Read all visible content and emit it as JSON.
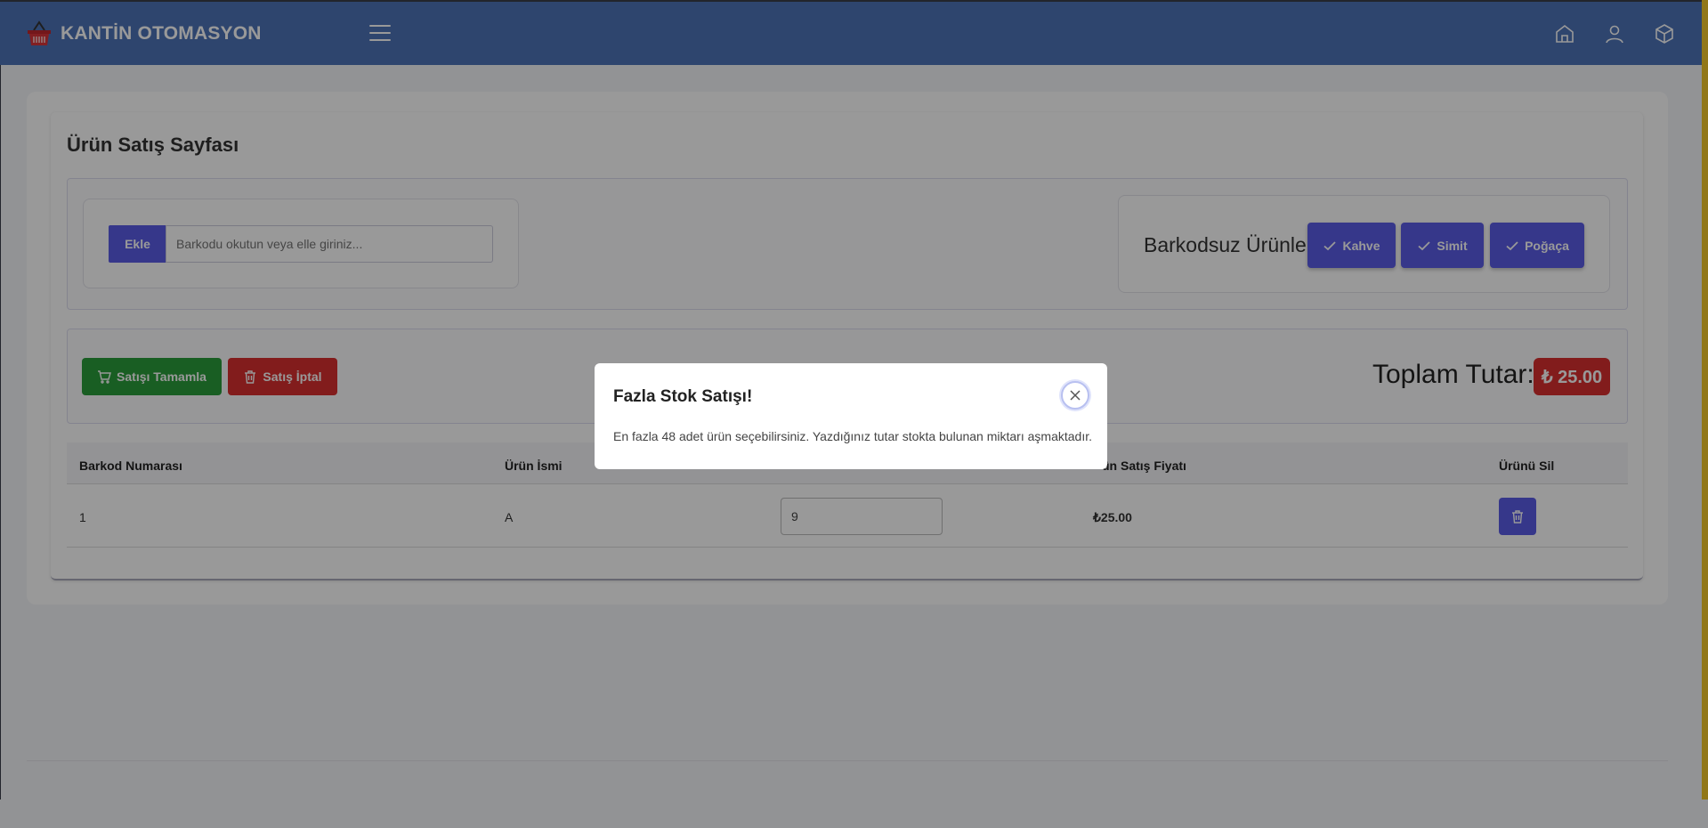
{
  "header": {
    "brand_title": "KANTİN OTOMASYON",
    "brand_color": "#4e73b8",
    "icons": [
      "home-icon",
      "user-icon",
      "box-icon"
    ]
  },
  "page": {
    "title": "Ürün Satış Sayfası"
  },
  "barcode": {
    "add_label": "Ekle",
    "placeholder": "Barkodu okutun veya elle giriniz..."
  },
  "no_barcode": {
    "label": "Barkodsuz Ürünler",
    "products": [
      {
        "label": "Kahve"
      },
      {
        "label": "Simit"
      },
      {
        "label": "Poğaça"
      }
    ]
  },
  "actions": {
    "complete_label": "Satışı Tamamla",
    "cancel_label": "Satış İptal",
    "complete_color": "#2a9d3b",
    "cancel_color": "#d93030"
  },
  "total": {
    "label": "Toplam Tutar:",
    "value": "₺ 25.00"
  },
  "table": {
    "headers": [
      "Barkod Numarası",
      "Ürün İsmi",
      "",
      "ün Satış Fiyatı",
      "Ürünü Sil"
    ],
    "rows": [
      {
        "barcode": "1",
        "name": "A",
        "quantity": "9",
        "price": "₺25.00"
      }
    ]
  },
  "modal": {
    "title": "Fazla Stok Satışı!",
    "message": "En fazla 48 adet ürün seçebilirsiniz. Yazdığınız tutar stokta bulunan miktarı aşmaktadır."
  }
}
